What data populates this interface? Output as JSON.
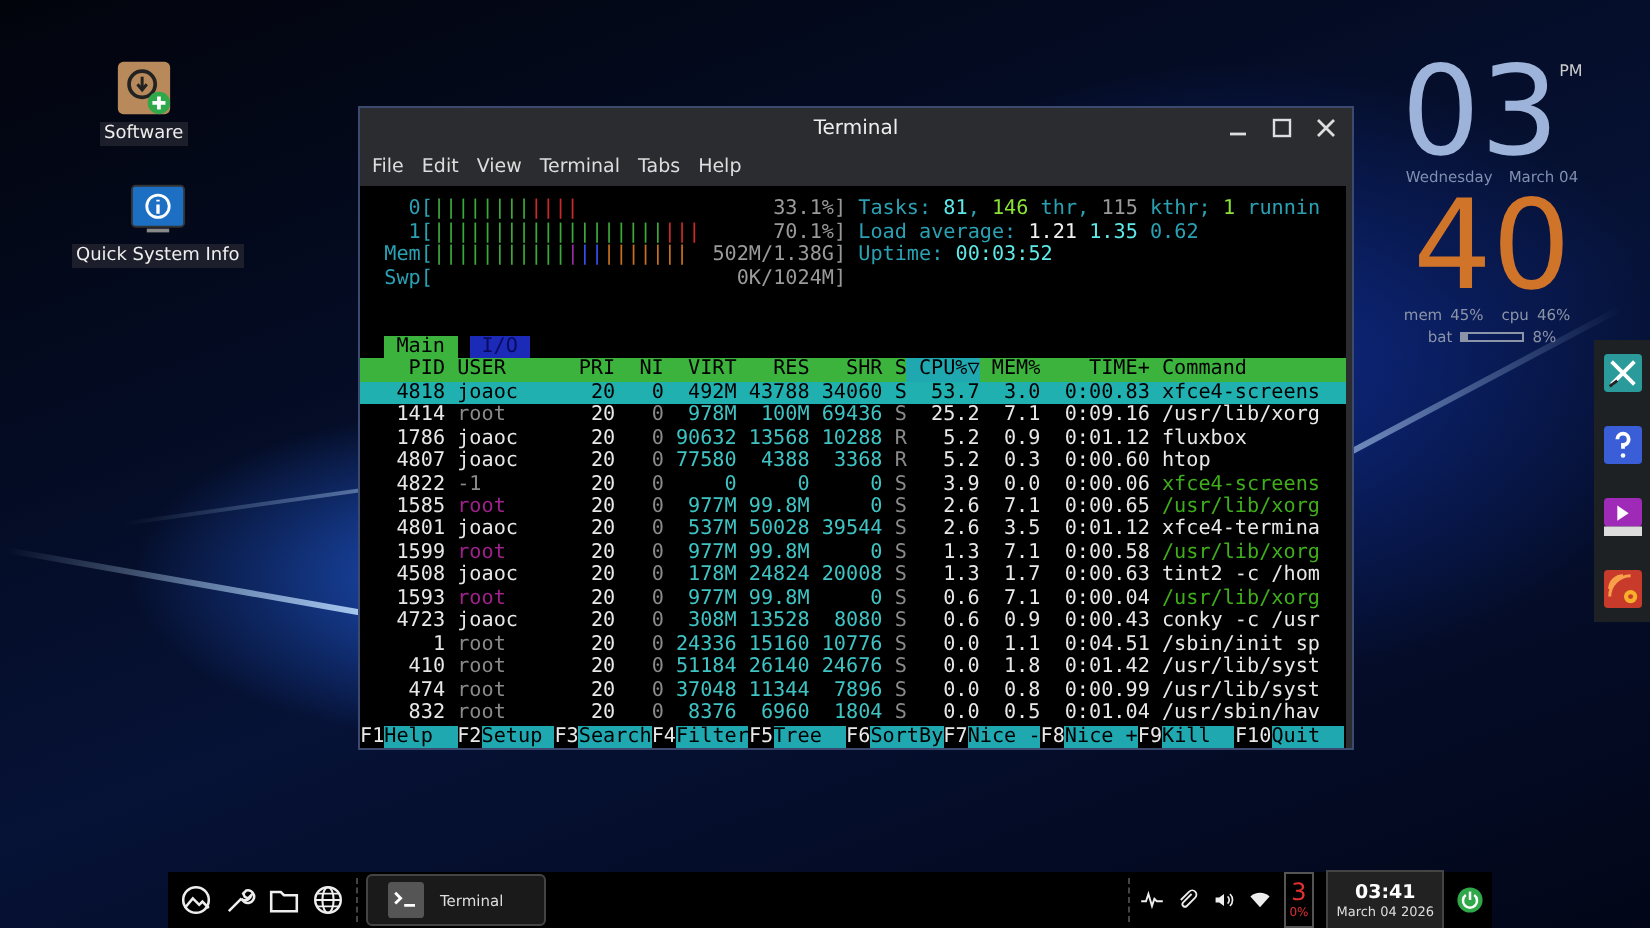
{
  "desktop_icons": [
    {
      "label": "Software"
    },
    {
      "label": "Quick System Info"
    }
  ],
  "window": {
    "title": "Terminal",
    "menu": [
      "File",
      "Edit",
      "View",
      "Terminal",
      "Tabs",
      "Help"
    ]
  },
  "htop": {
    "meters": [
      {
        "label": "0[",
        "reading": "33.1%]",
        "bars": [
          {
            "text": "||||||||",
            "color": "#3aa83a"
          },
          {
            "text": "||||",
            "color": "#cc2a2a"
          }
        ]
      },
      {
        "label": "1[",
        "reading": "70.1%]",
        "bars": [
          {
            "text": "|||||||||||||||||||",
            "color": "#3aa83a"
          },
          {
            "text": "|||",
            "color": "#cc2a2a"
          }
        ]
      },
      {
        "label": "Mem[",
        "reading": "502M/1.38G]",
        "bars": [
          {
            "text": "|||||||||||",
            "color": "#3aa83a"
          },
          {
            "text": "|",
            "color": "#9a2aa8"
          },
          {
            "text": "||",
            "color": "#3a4ef0"
          },
          {
            "text": "|||||||",
            "color": "#c8701c"
          }
        ]
      },
      {
        "label": "Swp[",
        "reading": "0K/1024M]"
      }
    ],
    "info": [
      [
        {
          "text": "Tasks: ",
          "color": "#2aa1b3"
        },
        {
          "text": "81",
          "color": "#5fe8e8"
        },
        {
          "text": ", ",
          "color": "#2aa1b3"
        },
        {
          "text": "146",
          "color": "#8ae234"
        },
        {
          "text": " thr, ",
          "color": "#2aa1b3"
        },
        {
          "text": "115",
          "color": "#9a9a9a"
        },
        {
          "text": " kthr; ",
          "color": "#2aa1b3"
        },
        {
          "text": "1",
          "color": "#8ae234"
        },
        {
          "text": " runnin",
          "color": "#2aa1b3"
        }
      ],
      [
        {
          "text": "Load average: ",
          "color": "#2aa1b3"
        },
        {
          "text": "1.21",
          "color": "#f0f0f0"
        },
        {
          "text": " 1.35",
          "color": "#5fe8e8"
        },
        {
          "text": " 0.62",
          "color": "#2aa1b3"
        }
      ],
      [
        {
          "text": "Uptime: ",
          "color": "#2aa1b3"
        },
        {
          "text": "00:03:52",
          "color": "#5fe8e8"
        }
      ]
    ],
    "tabs": [
      {
        "label": "Main",
        "selected": true
      },
      {
        "label": "I/O",
        "selected": false
      }
    ],
    "columns": [
      {
        "label": "PID",
        "sorted": false
      },
      {
        "label": "USER",
        "sorted": false
      },
      {
        "label": "PRI",
        "sorted": false
      },
      {
        "label": "NI",
        "sorted": false
      },
      {
        "label": "VIRT",
        "sorted": false
      },
      {
        "label": "RES",
        "sorted": false
      },
      {
        "label": "SHR",
        "sorted": false
      },
      {
        "label": "S",
        "sorted": false
      },
      {
        "label": "CPU%▽",
        "sorted": true
      },
      {
        "label": "MEM%",
        "sorted": false
      },
      {
        "label": "TIME+",
        "sorted": false
      },
      {
        "label": "Command",
        "sorted": false
      }
    ],
    "rows": [
      {
        "kind": "user",
        "selected": true,
        "cells": [
          "4818",
          "joaoc",
          "20",
          "0",
          "492M",
          "43788",
          "34060",
          "S",
          "53.7",
          "3.0",
          "0:00.83",
          "xfce4-screens"
        ]
      },
      {
        "kind": "system",
        "selected": false,
        "cells": [
          "1414",
          "root",
          "20",
          "0",
          "978M",
          "100M",
          "69436",
          "S",
          "25.2",
          "7.1",
          "0:09.16",
          "/usr/lib/xorg"
        ]
      },
      {
        "kind": "user",
        "selected": false,
        "cells": [
          "1786",
          "joaoc",
          "20",
          "0",
          "90632",
          "13568",
          "10288",
          "R",
          "5.2",
          "0.9",
          "0:01.12",
          "fluxbox"
        ]
      },
      {
        "kind": "user",
        "selected": false,
        "cells": [
          "4807",
          "joaoc",
          "20",
          "0",
          "77580",
          "4388",
          "3368",
          "R",
          "5.2",
          "0.3",
          "0:00.60",
          "htop"
        ]
      },
      {
        "kind": "other",
        "selected": false,
        "cells": [
          "4822",
          "-1",
          "20",
          "0",
          "0",
          "0",
          "0",
          "S",
          "3.9",
          "0.0",
          "0:00.06",
          "xfce4-screens"
        ]
      },
      {
        "kind": "thread",
        "selected": false,
        "cells": [
          "1585",
          "root",
          "20",
          "0",
          "977M",
          "99.8M",
          "0",
          "S",
          "2.6",
          "7.1",
          "0:00.65",
          "/usr/lib/xorg"
        ]
      },
      {
        "kind": "user",
        "selected": false,
        "cells": [
          "4801",
          "joaoc",
          "20",
          "0",
          "537M",
          "50028",
          "39544",
          "S",
          "2.6",
          "3.5",
          "0:01.12",
          "xfce4-termina"
        ]
      },
      {
        "kind": "thread",
        "selected": false,
        "cells": [
          "1599",
          "root",
          "20",
          "0",
          "977M",
          "99.8M",
          "0",
          "S",
          "1.3",
          "7.1",
          "0:00.58",
          "/usr/lib/xorg"
        ]
      },
      {
        "kind": "user",
        "selected": false,
        "cells": [
          "4508",
          "joaoc",
          "20",
          "0",
          "178M",
          "24824",
          "20008",
          "S",
          "1.3",
          "1.7",
          "0:00.63",
          "tint2 -c /hom"
        ]
      },
      {
        "kind": "thread",
        "selected": false,
        "cells": [
          "1593",
          "root",
          "20",
          "0",
          "977M",
          "99.8M",
          "0",
          "S",
          "0.6",
          "7.1",
          "0:00.04",
          "/usr/lib/xorg"
        ]
      },
      {
        "kind": "user",
        "selected": false,
        "cells": [
          "4723",
          "joaoc",
          "20",
          "0",
          "308M",
          "13528",
          "8080",
          "S",
          "0.6",
          "0.9",
          "0:00.43",
          "conky -c /usr"
        ]
      },
      {
        "kind": "system",
        "selected": false,
        "cells": [
          "1",
          "root",
          "20",
          "0",
          "24336",
          "15160",
          "10776",
          "S",
          "0.0",
          "1.1",
          "0:04.51",
          "/sbin/init sp"
        ]
      },
      {
        "kind": "system",
        "selected": false,
        "cells": [
          "410",
          "root",
          "20",
          "0",
          "51184",
          "26140",
          "24676",
          "S",
          "0.0",
          "1.8",
          "0:01.42",
          "/usr/lib/syst"
        ]
      },
      {
        "kind": "system",
        "selected": false,
        "cells": [
          "474",
          "root",
          "20",
          "0",
          "37048",
          "11344",
          "7896",
          "S",
          "0.0",
          "0.8",
          "0:00.99",
          "/usr/lib/syst"
        ]
      },
      {
        "kind": "system",
        "selected": false,
        "cells": [
          "832",
          "root",
          "20",
          "0",
          "8376",
          "6960",
          "1804",
          "S",
          "0.0",
          "0.5",
          "0:01.04",
          "/usr/sbin/hav"
        ]
      }
    ],
    "function_keys": [
      {
        "key": "F1",
        "label": "Help"
      },
      {
        "key": "F2",
        "label": "Setup"
      },
      {
        "key": "F3",
        "label": "Search"
      },
      {
        "key": "F4",
        "label": "Filter"
      },
      {
        "key": "F5",
        "label": "Tree"
      },
      {
        "key": "F6",
        "label": "SortBy"
      },
      {
        "key": "F7",
        "label": "Nice -"
      },
      {
        "key": "F8",
        "label": "Nice +"
      },
      {
        "key": "F9",
        "label": "Kill"
      },
      {
        "key": "F10",
        "label": "Quit"
      }
    ]
  },
  "conky": {
    "hour": "03",
    "ampm": "PM",
    "weekday": "Wednesday",
    "date": "March 04",
    "minute": "40",
    "stats": [
      {
        "label": "mem",
        "value": "45%"
      },
      {
        "label": "cpu",
        "value": "46%"
      }
    ],
    "battery": {
      "label": "bat",
      "level": 0.08,
      "reading": "8%"
    }
  },
  "taskbar": {
    "tasks": [
      {
        "label": "Terminal"
      }
    ],
    "notification": {
      "count": "3",
      "percent": "0%"
    },
    "clock": {
      "time": "03:41",
      "date": "March 04 2026"
    }
  }
}
